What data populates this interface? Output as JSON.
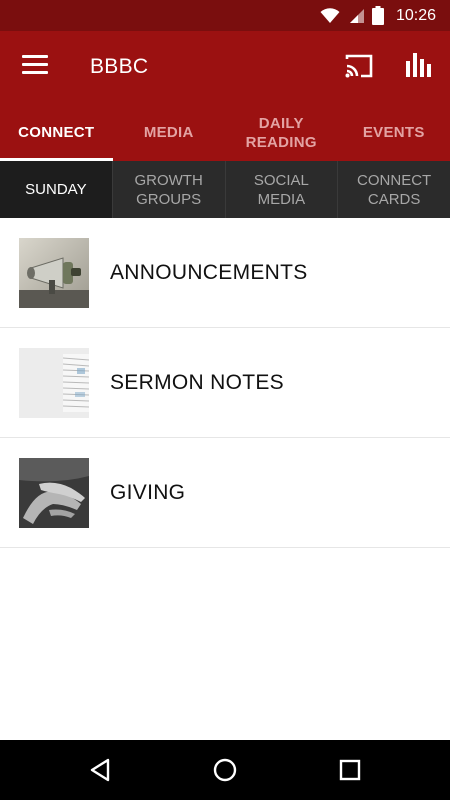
{
  "status_bar": {
    "time": "10:26"
  },
  "app_bar": {
    "title": "BBBC"
  },
  "top_tabs": [
    {
      "label": "CONNECT"
    },
    {
      "label": "MEDIA"
    },
    {
      "label": "DAILY\nREADING"
    },
    {
      "label": "EVENTS"
    }
  ],
  "sub_tabs": [
    {
      "label": "SUNDAY"
    },
    {
      "label": "GROWTH\nGROUPS"
    },
    {
      "label": "SOCIAL\nMEDIA"
    },
    {
      "label": "CONNECT\nCARDS"
    }
  ],
  "list": [
    {
      "label": "ANNOUNCEMENTS",
      "thumbnail": "megaphone-photo"
    },
    {
      "label": "SERMON NOTES",
      "thumbnail": "papers-photo"
    },
    {
      "label": "GIVING",
      "thumbnail": "hands-photo"
    }
  ],
  "colors": {
    "primary": "#9b1111",
    "status_bar": "#7a0e0e",
    "sub_tab_bar": "#2b2b2b",
    "inactive_tab_text": "#e3a3a3"
  },
  "icons": {
    "wifi": "wifi-icon",
    "signal": "signal-icon",
    "battery": "battery-icon",
    "menu": "menu-icon",
    "cast": "cast-icon",
    "stats": "bar-chart-icon",
    "back": "back-icon",
    "home": "home-icon",
    "recents": "recents-icon"
  }
}
